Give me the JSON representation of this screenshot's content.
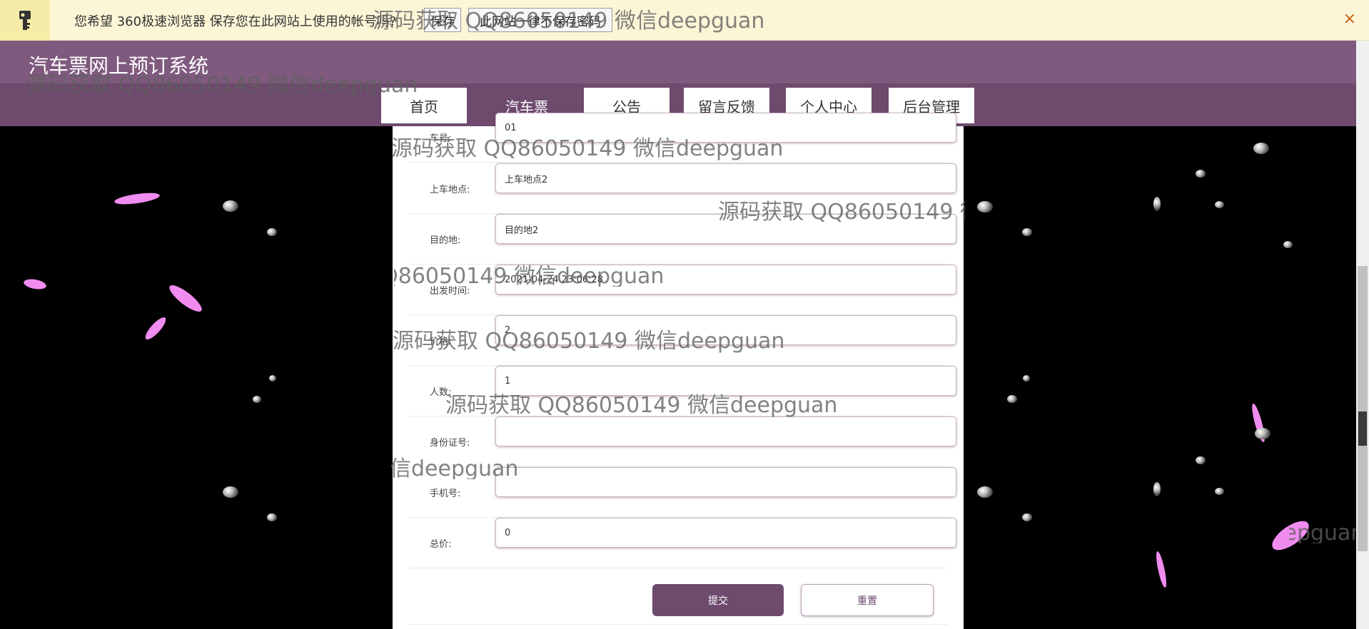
{
  "password_bar": {
    "message": "您希望 360极速浏览器 保存您在此网站上使用的帐号吗?",
    "save_label": "保存",
    "never_label": "此网站一律不保存密码",
    "close_glyph": "×",
    "key_icon": "key-icon"
  },
  "header": {
    "site_title": "汽车票网上预订系统"
  },
  "nav": {
    "items": [
      {
        "label": "首页",
        "active": false
      },
      {
        "label": "汽车票",
        "active": true
      },
      {
        "label": "公告",
        "active": false
      },
      {
        "label": "留言反馈",
        "active": false
      },
      {
        "label": "个人中心",
        "active": false
      },
      {
        "label": "后台管理",
        "active": false
      }
    ]
  },
  "form": {
    "fields": [
      {
        "label": "车号:",
        "value": "01"
      },
      {
        "label": "上车地点:",
        "value": "上车地点2"
      },
      {
        "label": "目的地:",
        "value": "目的地2"
      },
      {
        "label": "出发时间:",
        "value": "2021-04-24 23:06:28"
      },
      {
        "label": "价格:",
        "value": "2"
      },
      {
        "label": "人数:",
        "value": "1"
      },
      {
        "label": "身份证号:",
        "value": ""
      },
      {
        "label": "手机号:",
        "value": ""
      },
      {
        "label": "总价:",
        "value": "0"
      }
    ],
    "submit_label": "提交",
    "reset_label": "重置"
  },
  "watermark": {
    "text": "源码获取 QQ86050149 微信deepguan"
  },
  "colors": {
    "brand": "#6e4a6d",
    "brand_light": "#7f5a7e",
    "password_bar": "#fcf6d7",
    "petal": "#f08cf0"
  }
}
